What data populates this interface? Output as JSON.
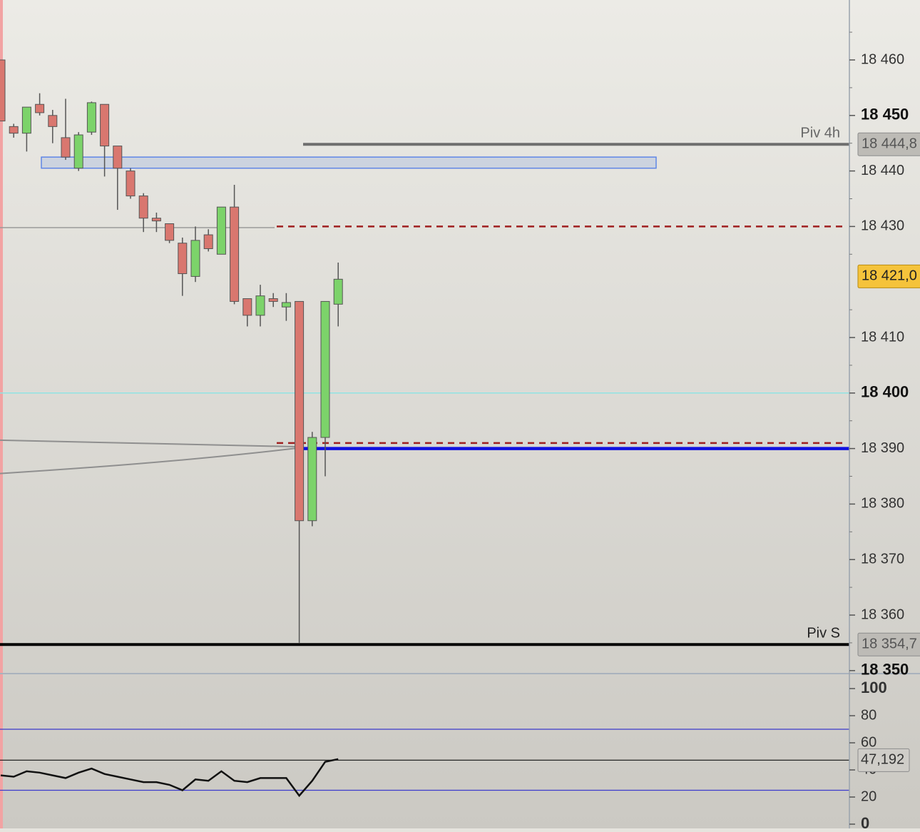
{
  "chart_data": [
    {
      "type": "candlestick",
      "title": "",
      "xlabel": "",
      "ylabel": "",
      "ylim": [
        18348,
        18476
      ],
      "grid": false,
      "y_ticks": [
        {
          "value": 18460,
          "label": "18 460",
          "major": false
        },
        {
          "value": 18450,
          "label": "18 450",
          "major": true
        },
        {
          "value": 18440,
          "label": "18 440",
          "major": false
        },
        {
          "value": 18430,
          "label": "18 430",
          "major": false
        },
        {
          "value": 18410,
          "label": "18 410",
          "major": false
        },
        {
          "value": 18400,
          "label": "18 400",
          "major": true
        },
        {
          "value": 18390,
          "label": "18 390",
          "major": false
        },
        {
          "value": 18380,
          "label": "18 380",
          "major": false
        },
        {
          "value": 18370,
          "label": "18 370",
          "major": false
        },
        {
          "value": 18360,
          "label": "18 360",
          "major": false
        },
        {
          "value": 18350,
          "label": "18 350",
          "major": true
        }
      ],
      "price_tags": [
        {
          "value": 18444.8,
          "label": "18 444,8",
          "style": "gray"
        },
        {
          "value": 18421.0,
          "label": "18 421,0",
          "style": "yellow"
        },
        {
          "value": 18354.7,
          "label": "18 354,7",
          "style": "gray"
        }
      ],
      "candles": [
        {
          "open": 18460,
          "high": 18460,
          "low": 18449,
          "close": 18449
        },
        {
          "open": 18448,
          "high": 18448.5,
          "low": 18446,
          "close": 18446.8
        },
        {
          "open": 18446.8,
          "high": 18451.5,
          "low": 18443.5,
          "close": 18451.5
        },
        {
          "open": 18452,
          "high": 18454,
          "low": 18450,
          "close": 18450.5
        },
        {
          "open": 18450,
          "high": 18451,
          "low": 18445,
          "close": 18448
        },
        {
          "open": 18446,
          "high": 18453,
          "low": 18442,
          "close": 18442.5
        },
        {
          "open": 18440.5,
          "high": 18447,
          "low": 18440,
          "close": 18446.5
        },
        {
          "open": 18447,
          "high": 18452.5,
          "low": 18446.5,
          "close": 18452.3
        },
        {
          "open": 18452,
          "high": 18452,
          "low": 18439,
          "close": 18444.5
        },
        {
          "open": 18444.5,
          "high": 18444.5,
          "low": 18433,
          "close": 18440.5
        },
        {
          "open": 18440,
          "high": 18440.5,
          "low": 18435,
          "close": 18435.5
        },
        {
          "open": 18435.5,
          "high": 18436,
          "low": 18429,
          "close": 18431.5
        },
        {
          "open": 18431.5,
          "high": 18432.5,
          "low": 18429,
          "close": 18431
        },
        {
          "open": 18430.5,
          "high": 18430.5,
          "low": 18427,
          "close": 18427.5
        },
        {
          "open": 18427,
          "high": 18428,
          "low": 18417.5,
          "close": 18421.5
        },
        {
          "open": 18421,
          "high": 18430,
          "low": 18420,
          "close": 18427.5
        },
        {
          "open": 18428.5,
          "high": 18429.5,
          "low": 18425.5,
          "close": 18426
        },
        {
          "open": 18425,
          "high": 18433.5,
          "low": 18425,
          "close": 18433.5
        },
        {
          "open": 18433.5,
          "high": 18437.5,
          "low": 18416,
          "close": 18416.5
        },
        {
          "open": 18417,
          "high": 18417,
          "low": 18412,
          "close": 18414
        },
        {
          "open": 18414,
          "high": 18419.5,
          "low": 18412,
          "close": 18417.5
        },
        {
          "open": 18417,
          "high": 18418,
          "low": 18415.5,
          "close": 18416.5
        },
        {
          "open": 18415.5,
          "high": 18418,
          "low": 18413,
          "close": 18416.3
        },
        {
          "open": 18416.5,
          "high": 18416.5,
          "low": 18355,
          "close": 18377
        },
        {
          "open": 18377,
          "high": 18393,
          "low": 18376,
          "close": 18392
        },
        {
          "open": 18392,
          "high": 18416.5,
          "low": 18385,
          "close": 18416.5
        },
        {
          "open": 18416,
          "high": 18423.5,
          "low": 18412,
          "close": 18420.5
        }
      ],
      "levels": [
        {
          "value": 18444.8,
          "label": "Piv 4h",
          "style": "solid-gray"
        },
        {
          "value": 18430.0,
          "label": "",
          "style": "dashed-red"
        },
        {
          "value": 18391.0,
          "label": "",
          "style": "dashed-red"
        },
        {
          "value": 18390.0,
          "label": "",
          "style": "solid-blue"
        },
        {
          "value": 18400.0,
          "label": "",
          "style": "thin-cyan"
        },
        {
          "value": 18354.7,
          "label": "Piv S",
          "style": "solid-black"
        }
      ],
      "zone": {
        "low": 18440.5,
        "high": 18442.5
      },
      "colors": {
        "up": "#7cd36a",
        "down": "#d9776f",
        "wick": "#555555",
        "zone": "#5f86e6",
        "blue_level": "#1010e0",
        "red_level": "#a02020",
        "cyan_level": "#8fe3e3"
      }
    },
    {
      "type": "line",
      "title": "",
      "xlabel": "",
      "ylabel": "",
      "ylim": [
        0,
        100
      ],
      "grid": false,
      "y_ticks": [
        {
          "value": 100,
          "label": "100",
          "major": true
        },
        {
          "value": 80,
          "label": "80",
          "major": false
        },
        {
          "value": 60,
          "label": "60",
          "major": false
        },
        {
          "value": 40,
          "label": "40",
          "major": false
        },
        {
          "value": 20,
          "label": "20",
          "major": false
        },
        {
          "value": 0,
          "label": "0",
          "major": true
        }
      ],
      "current_tag": {
        "value": 47.192,
        "label": "47,192"
      },
      "bands": [
        70,
        25
      ],
      "series": [
        {
          "name": "",
          "values": [
            36,
            35,
            39,
            38,
            36,
            34,
            38,
            41,
            37,
            35,
            33,
            31,
            31,
            29,
            25,
            33,
            32,
            39,
            32,
            31,
            34,
            34,
            34,
            21,
            32,
            46,
            48
          ]
        }
      ]
    }
  ]
}
